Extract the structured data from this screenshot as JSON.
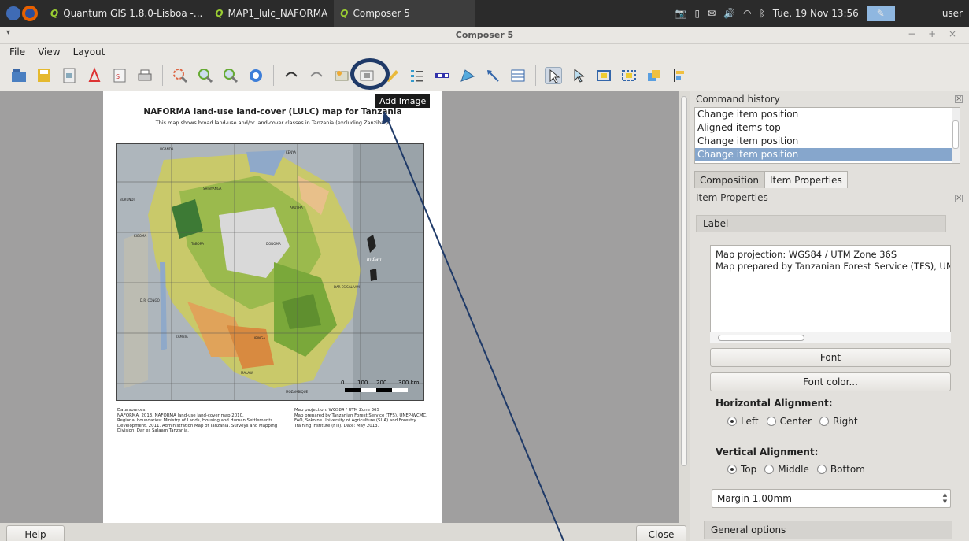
{
  "topbar": {
    "tasks": [
      "Quantum GIS 1.8.0-Lisboa -...",
      "MAP1_lulc_NAFORMA",
      "Composer 5"
    ],
    "datetime": "Tue, 19 Nov 13:56",
    "user": "user"
  },
  "window": {
    "title": "Composer 5",
    "controls": "− + ×"
  },
  "menu": [
    "File",
    "View",
    "Layout"
  ],
  "tooltip": "Add Image",
  "page": {
    "title": "NAFORMA land-use land-cover (LULC) map for Tanzania",
    "subtitle": "This map shows broad land-use and/or land-cover classes in Tanzania (excluding Zanzibar).",
    "scalebar": [
      "0",
      "100",
      "200",
      "300 km"
    ],
    "map_labels": [
      "UGANDA",
      "KENYA",
      "BURUNDI",
      "SHINYANGA",
      "ARUSHA",
      "TABORA",
      "D.R. CONGO",
      "DODOMA",
      "DAR ES SALAAM",
      "Indian",
      "ZAMBIA",
      "MALAWI",
      "MOZAMBIQUE",
      "IRINGA",
      "KIGOMA"
    ],
    "data_sources": "Data sources:\nNAFORMA. 2013.  NAFORMA land-use land-cover map 2010.\nRegional boundaries: Ministry of Lands, Housing and Human Settlements Development. 2011. Administration Map of Tanzania. Surveys and Mapping Division, Dar es Salaam Tanzania.",
    "projection_note": "Map projection: WGS84 / UTM Zone 36S\nMap prepared by Tanzanian Forest Service (TFS), UNEP-WCMC, FAO, Sokoine University of Agriculture (SUA) and Forestry Training Institute (FTI). Date: May 2013."
  },
  "buttons": {
    "help": "Help",
    "close": "Close"
  },
  "dock": {
    "history_title": "Command history",
    "history": [
      "Change item position",
      "Aligned items top",
      "Change item position",
      "Change item position"
    ],
    "tabs": [
      "Composition",
      "Item Properties"
    ],
    "properties_title": "Item Properties",
    "label_group": "Label",
    "label_text_line1": "Map projection: WGS84 / UTM Zone 36S",
    "label_text_line2": "Map prepared by Tanzanian Forest Service (TFS), UNEP-W",
    "font_button": "Font",
    "font_color_button": "Font color...",
    "halign_label": "Horizontal Alignment:",
    "halign_options": [
      "Left",
      "Center",
      "Right"
    ],
    "valign_label": "Vertical Alignment:",
    "valign_options": [
      "Top",
      "Middle",
      "Bottom"
    ],
    "margin": "Margin 1.00mm",
    "general_options": "General options"
  }
}
